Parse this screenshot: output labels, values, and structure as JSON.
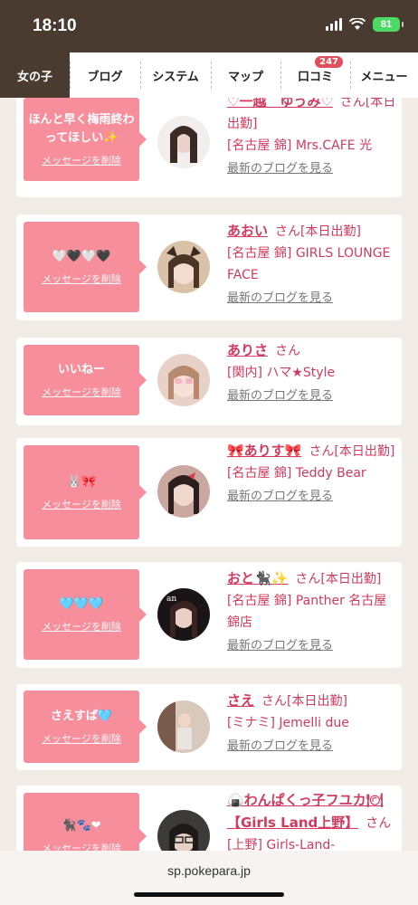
{
  "status": {
    "time": "18:10",
    "battery": "81"
  },
  "tabs": [
    {
      "label": "女の子"
    },
    {
      "label": "ブログ"
    },
    {
      "label": "システム"
    },
    {
      "label": "マップ"
    },
    {
      "label": "口コミ",
      "badge": "247"
    },
    {
      "label": "メニュー"
    }
  ],
  "delete_label": "メッセージを削除",
  "blog_link": "最新のブログを見る",
  "san": "さん",
  "cards": [
    {
      "message": "ほんと早く梅雨終わってほしい✨",
      "name": "♡一越　ゆうみ♡",
      "suffix": "[本日出勤]",
      "shop": "[名古屋 錦] Mrs.CAFE 光"
    },
    {
      "message": "🤍🖤🤍🖤",
      "name": "あおい",
      "suffix": "[本日出勤]",
      "shop": "[名古屋 錦] GIRLS LOUNGE FACE"
    },
    {
      "message": "いいねー",
      "name": "ありさ",
      "suffix": "",
      "shop": "[関内] ハマ★Style"
    },
    {
      "message": "🐰🎀",
      "name": "🎀ありす🎀",
      "suffix": "[本日出勤]",
      "shop": "[名古屋 錦] Teddy Bear"
    },
    {
      "message": "🩵🩵🩵",
      "name": "おと🐈‍⬛✨",
      "suffix": "[本日出勤]",
      "shop": "[名古屋 錦] Panther 名古屋錦店"
    },
    {
      "message": "さえすぱ🩵",
      "name": "さえ",
      "suffix": "[本日出勤]",
      "shop": "[ミナミ] Jemelli due"
    },
    {
      "message": "🐈‍⬛🐾❤",
      "name": "🍙わんぱくっ子フユカ🍽【Girls Land上野】",
      "suffix": "",
      "shop": "[上野] Girls-Land-"
    }
  ],
  "browser": {
    "url": "sp.pokepara.jp"
  }
}
